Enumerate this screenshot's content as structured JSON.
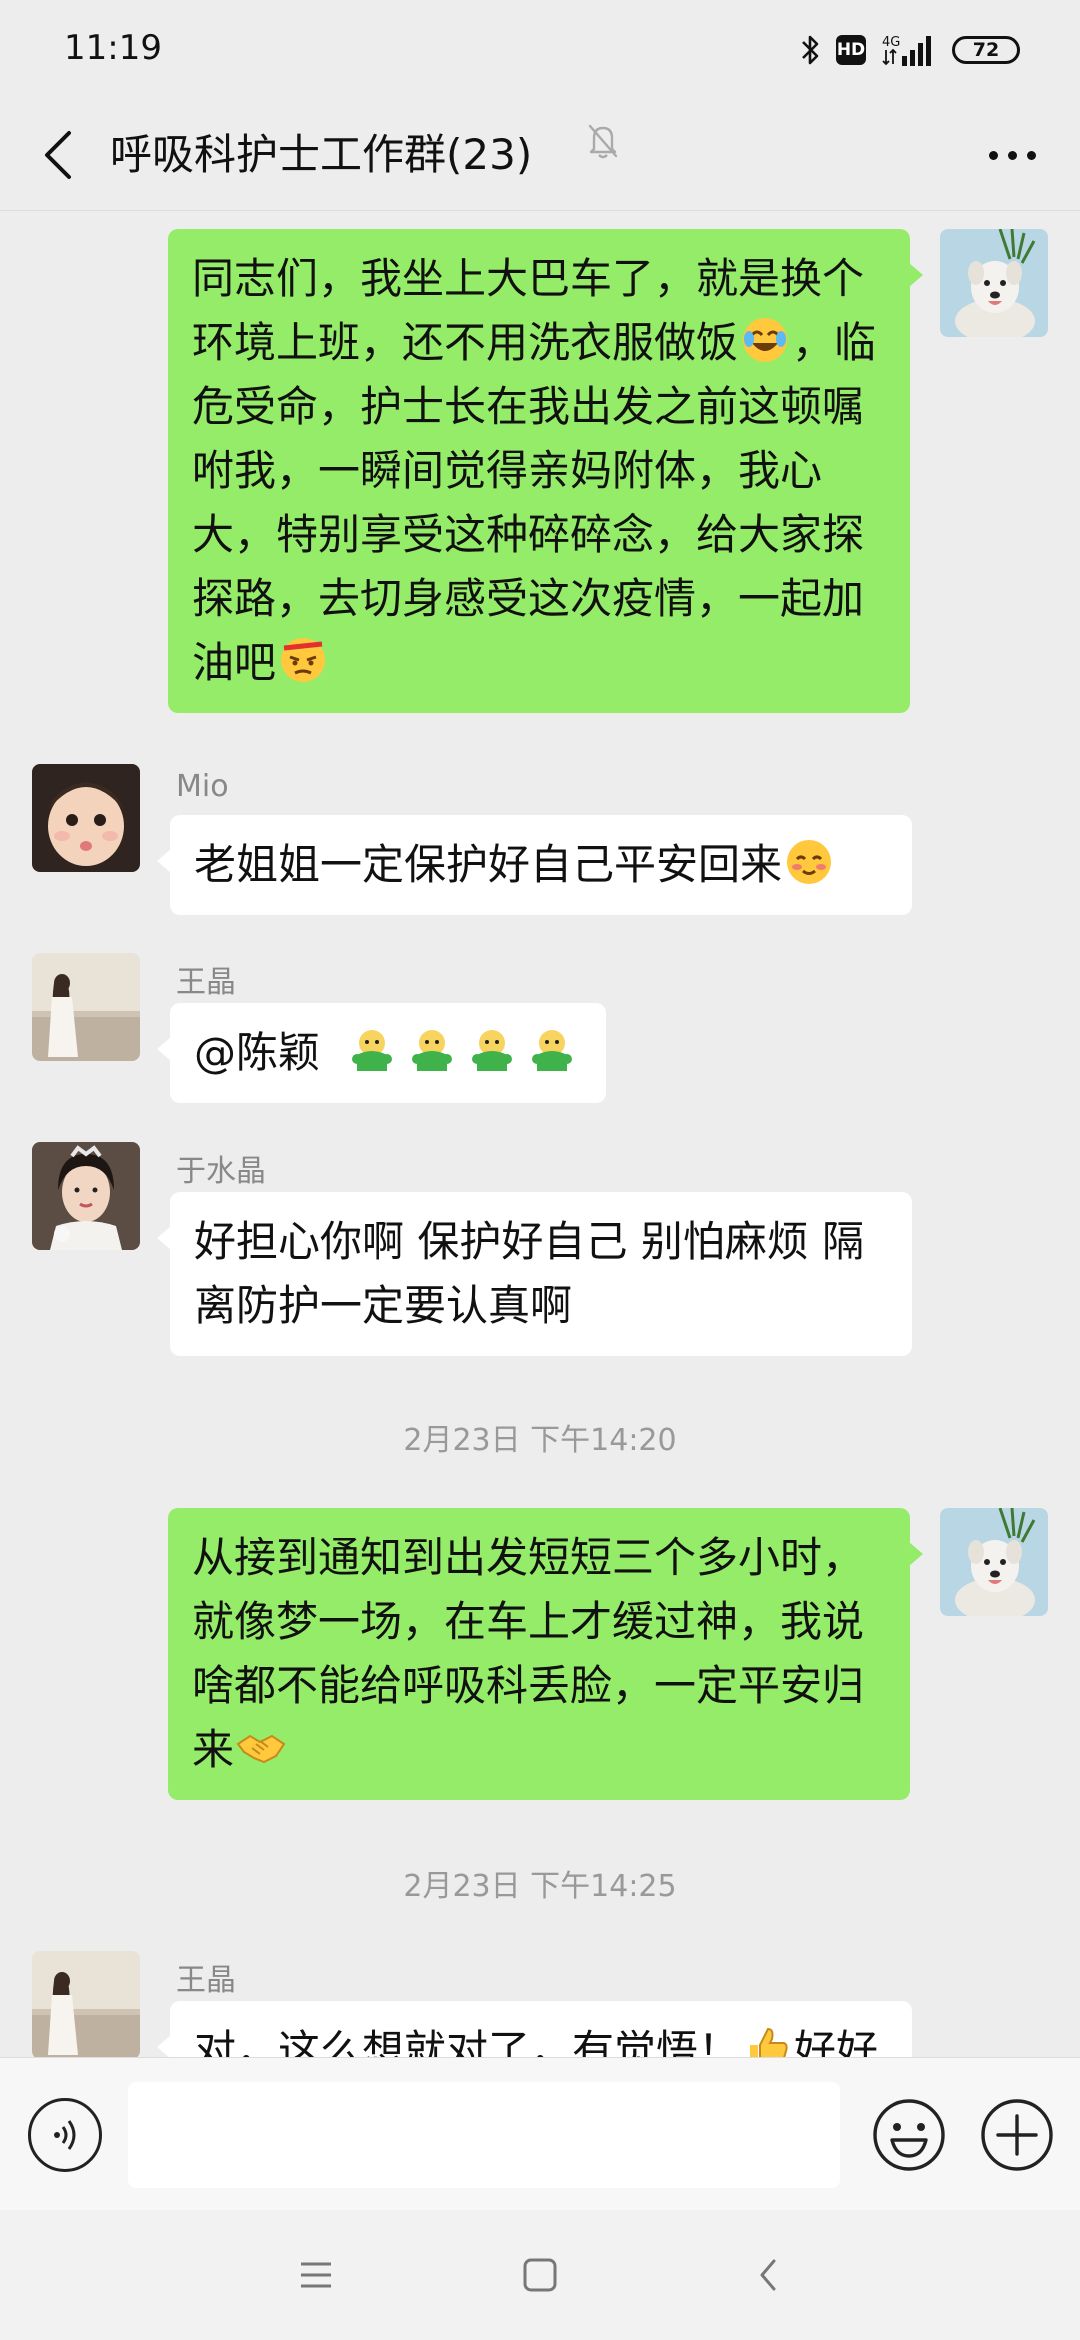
{
  "status_bar": {
    "time": "11:19",
    "network": "4G",
    "battery": "72",
    "icons": [
      "bluetooth-icon",
      "hd-icon",
      "signal-icon",
      "battery-icon"
    ]
  },
  "header": {
    "title": "呼吸科护士工作群(23)",
    "icons": [
      "back-arrow-icon",
      "mute-bell-icon",
      "more-icon"
    ]
  },
  "messages": [
    {
      "direction": "out",
      "text": "同志们，我坐上大巴车了，就是换个环境上班，还不用洗衣服做饭",
      "text_b": "，临危受命，护士长在我出发之前这顿嘱咐我，一瞬间觉得亲妈附体，我心大，特别享受这种碎碎念，给大家探探路，去切身感受这次疫情，一起加油吧",
      "emojis": [
        "laughing-tears-emoji",
        "determined-face-emoji"
      ]
    },
    {
      "direction": "in",
      "sender": "Mio",
      "text": "老姐姐一定保护好自己平安回来",
      "emojis": [
        "blushing-face-emoji"
      ]
    },
    {
      "direction": "in",
      "sender": "王晶",
      "text": "@陈颖 ",
      "emojis": [
        "green-doll-emoji",
        "green-doll-emoji",
        "green-doll-emoji",
        "green-doll-emoji"
      ]
    },
    {
      "direction": "in",
      "sender": "于水晶",
      "text": "好担心你啊 保护好自己 别怕麻烦 隔离防护一定要认真啊"
    },
    {
      "type": "timestamp",
      "text": "2月23日 下午14:20"
    },
    {
      "direction": "out",
      "text": "从接到通知到出发短短三个多小时，就像梦一场，在车上才缓过神，我说啥都不能给呼吸科丢脸，一定平安归来",
      "emojis": [
        "handshake-emoji"
      ]
    },
    {
      "type": "timestamp",
      "text": "2月23日 下午14:25"
    },
    {
      "direction": "in",
      "sender": "王晶",
      "text": "对，这么想就对了，有觉悟！",
      "text_b": "好好",
      "emojis": [
        "thumbs-up-emoji"
      ]
    }
  ],
  "input_bar": {
    "placeholder": "",
    "icons": [
      "voice-icon",
      "emoji-icon",
      "plus-icon"
    ]
  },
  "system_nav": {
    "icons": [
      "menu-icon",
      "home-icon",
      "back-icon"
    ]
  }
}
